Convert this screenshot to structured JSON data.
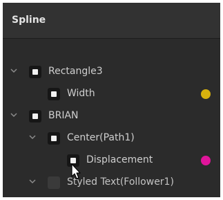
{
  "panel": {
    "title": "Spline"
  },
  "tree": {
    "items": [
      {
        "label": "Rectangle3",
        "expanded": true,
        "checked": true
      },
      {
        "label": "Width",
        "checked": true,
        "color_dot": "#d8b20e"
      },
      {
        "label": "BRIAN",
        "expanded": true,
        "checked": true
      },
      {
        "label": "Center(Path1)",
        "expanded": true,
        "checked": true
      },
      {
        "label": "Displacement",
        "checked": true,
        "color_dot": "#e0159b"
      },
      {
        "label": "Styled Text(Follower1)",
        "expanded": true,
        "checked": false
      }
    ]
  },
  "icons": {
    "expand": "chevron-down-icon",
    "cursor": "mouse-pointer-icon"
  }
}
